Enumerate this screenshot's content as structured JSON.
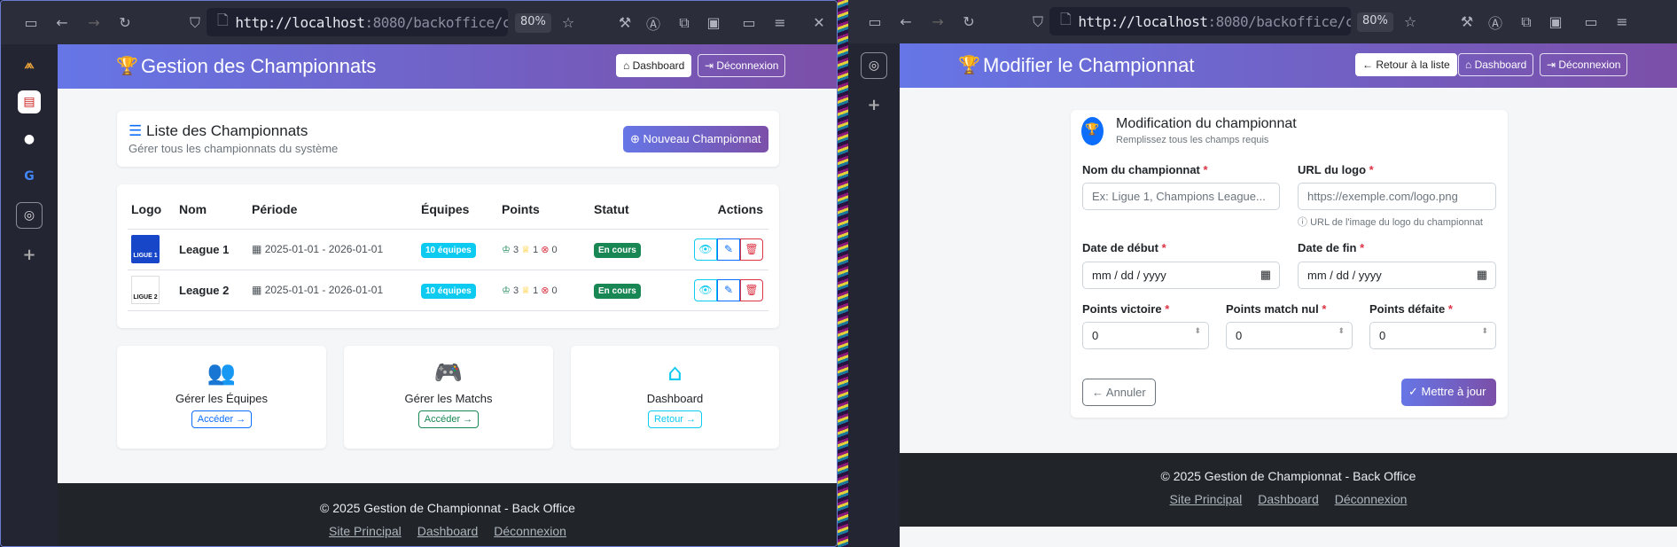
{
  "left": {
    "url": {
      "host": "http://localhost",
      "rest": ":8080/backoffice/championsh",
      "zoom": "80%"
    },
    "header": {
      "title": "Gestion des Championnats",
      "dashboard": "Dashboard",
      "logout": "Déconnexion"
    },
    "list": {
      "title": "Liste des Championnats",
      "subtitle": "Gérer tous les championnats du système",
      "new_button": "Nouveau Championnat"
    },
    "table": {
      "headers": [
        "Logo",
        "Nom",
        "Période",
        "Équipes",
        "Points",
        "Statut",
        "Actions"
      ],
      "rows": [
        {
          "logo": "LIGUE 1",
          "name": "League 1",
          "period": "2025-01-01 - 2026-01-01",
          "teams": "10 équipes",
          "win": "3",
          "draw": "1",
          "loss": "0",
          "status": "En cours"
        },
        {
          "logo": "LIGUE 2",
          "name": "League 2",
          "period": "2025-01-01 - 2026-01-01",
          "teams": "10 équipes",
          "win": "3",
          "draw": "1",
          "loss": "0",
          "status": "En cours"
        }
      ]
    },
    "tiles": [
      {
        "label": "Gérer les Équipes",
        "button": "Accéder →",
        "color": "#0d6efd"
      },
      {
        "label": "Gérer les Matchs",
        "button": "Accéder →",
        "color": "#198754"
      },
      {
        "label": "Dashboard",
        "button": "Retour →",
        "color": "#0dcaf0"
      }
    ],
    "footer": {
      "copyright": "© 2025 Gestion de Championnat - Back Office",
      "links": [
        "Site Principal",
        "Dashboard",
        "Déconnexion"
      ]
    }
  },
  "right": {
    "url": {
      "host": "http://localhost",
      "rest": ":8080/backoffice/championsh",
      "zoom": "80%"
    },
    "header": {
      "title": "Modifier le Championnat",
      "back": "Retour à la liste",
      "dashboard": "Dashboard",
      "logout": "Déconnexion"
    },
    "form": {
      "title": "Modification du championnat",
      "subtitle": "Remplissez tous les champs requis",
      "name_label": "Nom du championnat",
      "name_placeholder": "Ex: Ligue 1, Champions League...",
      "logo_label": "URL du logo",
      "logo_placeholder": "https://exemple.com/logo.png",
      "logo_help": "URL de l'image du logo du championnat",
      "start_label": "Date de début",
      "start_value": "mm / dd / yyyy",
      "end_label": "Date de fin",
      "end_value": "mm / dd / yyyy",
      "win_label": "Points victoire",
      "win_value": "0",
      "draw_label": "Points match nul",
      "draw_value": "0",
      "loss_label": "Points défaite",
      "loss_value": "0",
      "cancel": "Annuler",
      "submit": "Mettre à jour"
    },
    "footer": {
      "copyright": "© 2025 Gestion de Championnat - Back Office",
      "links": [
        "Site Principal",
        "Dashboard",
        "Déconnexion"
      ]
    }
  },
  "colors": {
    "accent": "#6a6fde",
    "success": "#198754",
    "info": "#0dcaf0",
    "danger": "#dc3545"
  }
}
